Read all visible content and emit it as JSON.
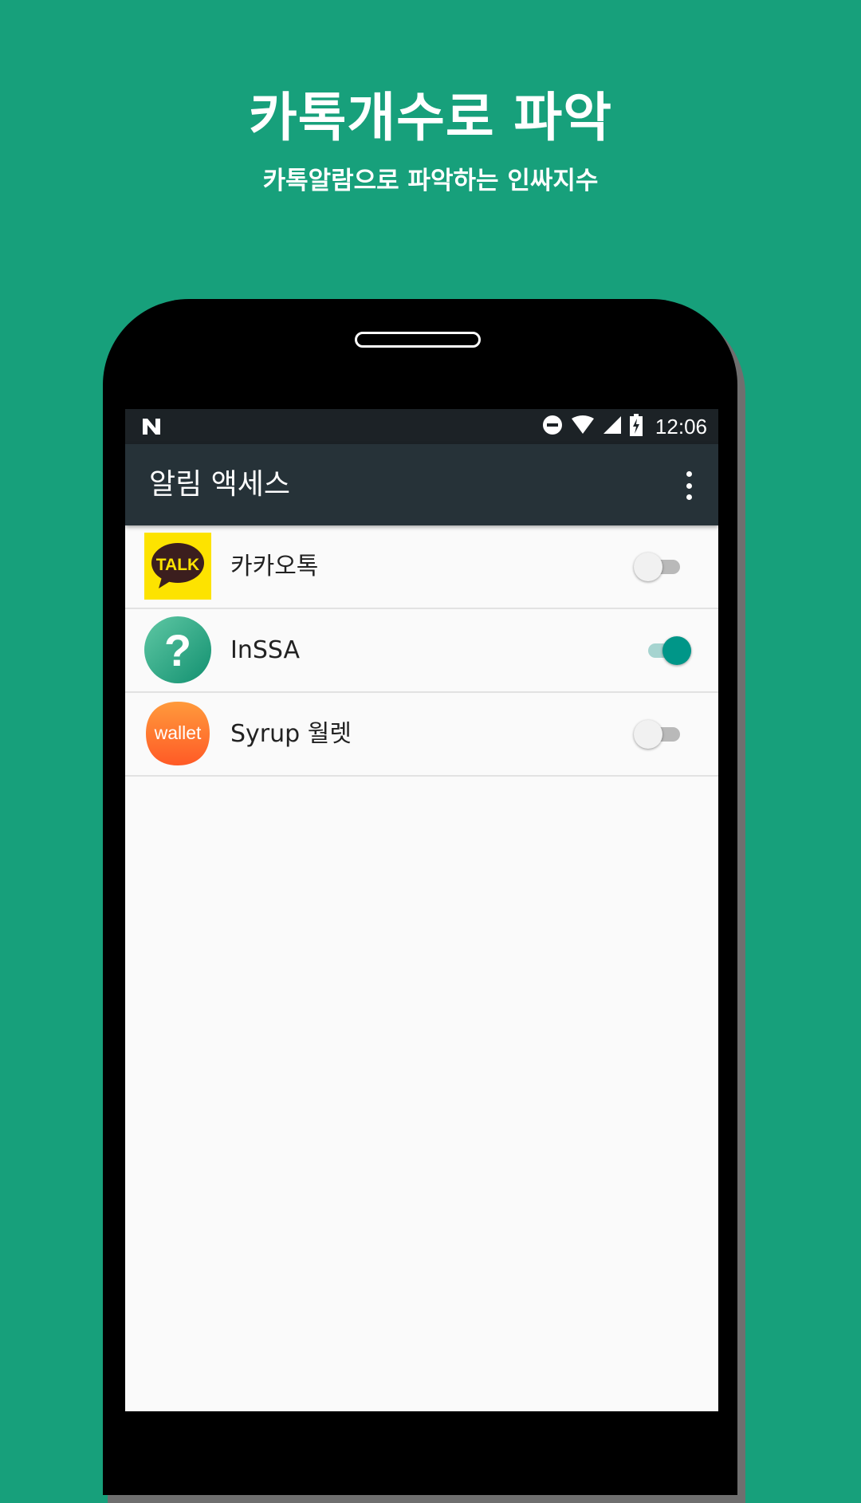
{
  "colors": {
    "background": "#17a07b",
    "status_bar": "#1c2226",
    "app_bar": "#263238",
    "toggle_on": "#009688"
  },
  "promo": {
    "headline": "카톡개수로 파악",
    "subline": "카톡알람으로 파악하는 인싸지수"
  },
  "status_bar": {
    "icons": [
      "n-logo-icon",
      "do-not-disturb-icon",
      "wifi-icon",
      "cellular-signal-icon",
      "battery-charging-icon"
    ],
    "time": "12:06"
  },
  "app_bar": {
    "title": "알림 액세스",
    "menu_icon": "more-vert-icon"
  },
  "apps": [
    {
      "name": "카카오톡",
      "icon": "kakaotalk-icon",
      "icon_text": "TALK",
      "enabled": false
    },
    {
      "name": "InSSA",
      "icon": "inssa-question-icon",
      "icon_text": "?",
      "enabled": true
    },
    {
      "name": "Syrup 월렛",
      "icon": "syrup-wallet-icon",
      "icon_text": "wallet",
      "enabled": false
    }
  ]
}
